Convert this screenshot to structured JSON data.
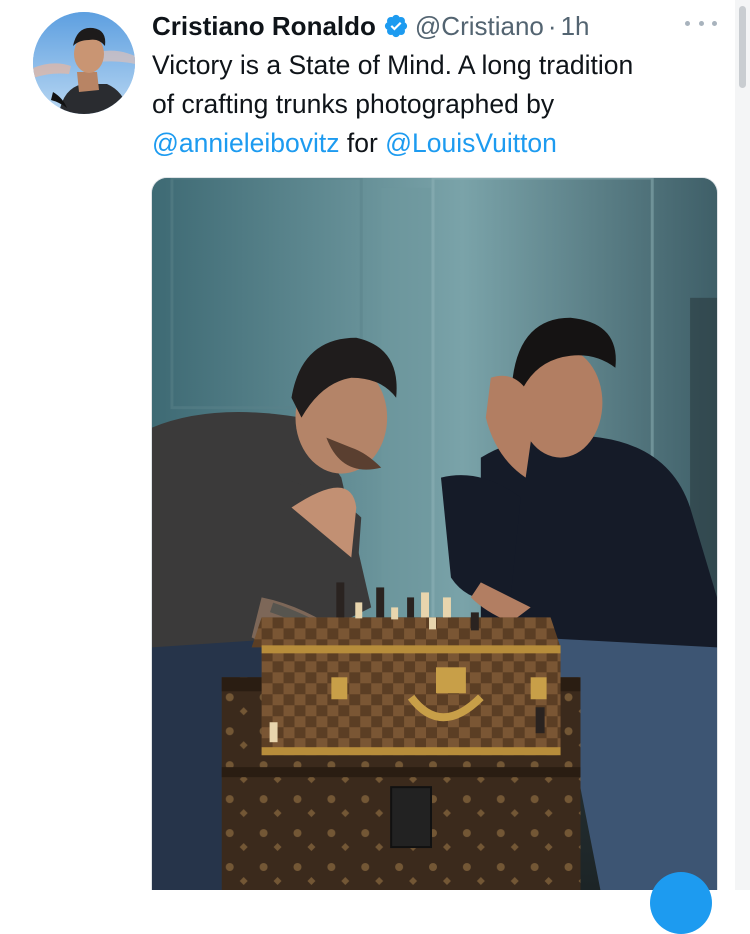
{
  "tweet": {
    "author_name": "Cristiano Ronaldo",
    "handle": "@Cristiano",
    "separator": "·",
    "time": "1h",
    "verified_icon": "verified-badge-icon",
    "more_icon": "more-options-icon",
    "text": {
      "line1": "Victory is a State of Mind. A long tradition",
      "line2": "of crafting trunks photographed by",
      "mention1": "@annieleibovitz",
      "connector": " for ",
      "mention2": "@LouisVuitton"
    },
    "media_alt": "Two men playing chess on a Louis Vuitton trunk"
  },
  "colors": {
    "accent": "#1d9bf0",
    "text": "#0f1419",
    "secondary_text": "#536471"
  }
}
